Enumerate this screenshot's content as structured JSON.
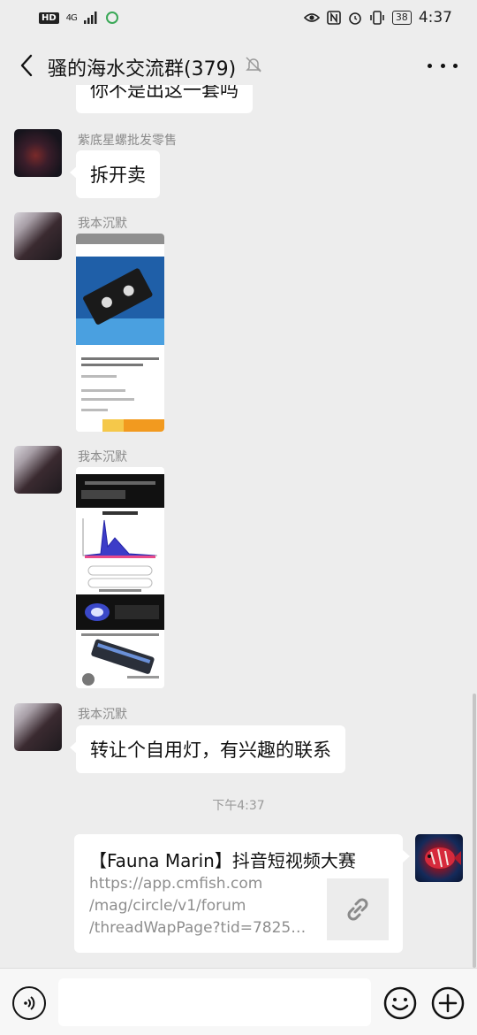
{
  "status_bar": {
    "left_badge": "HD",
    "network": "4G",
    "battery": "38",
    "time": "4:37"
  },
  "header": {
    "title": "骚的海水交流群(379)"
  },
  "messages": {
    "partial_top_text": "你不是出这一套吗",
    "m1": {
      "sender": "紫底星螺批发零售",
      "text": "拆开卖"
    },
    "m2": {
      "sender": "我本沉默"
    },
    "m3": {
      "sender": "我本沉默"
    },
    "m4": {
      "sender": "我本沉默",
      "text": "转让个自用灯，有兴趣的联系"
    },
    "timestamp": "下午4:37",
    "link_card": {
      "title": "【Fauna Marin】抖音短视频大赛",
      "url_line1": "https://app.cmfish.com",
      "url_line2": "/mag/circle/v1/forum",
      "url_line3": "/threadWapPage?tid=78256..."
    }
  },
  "input": {
    "placeholder": ""
  },
  "icons": [
    "back-arrow-icon",
    "mute-bell-icon",
    "more-icon",
    "link-icon",
    "voice-icon",
    "emoji-icon",
    "plus-icon"
  ]
}
